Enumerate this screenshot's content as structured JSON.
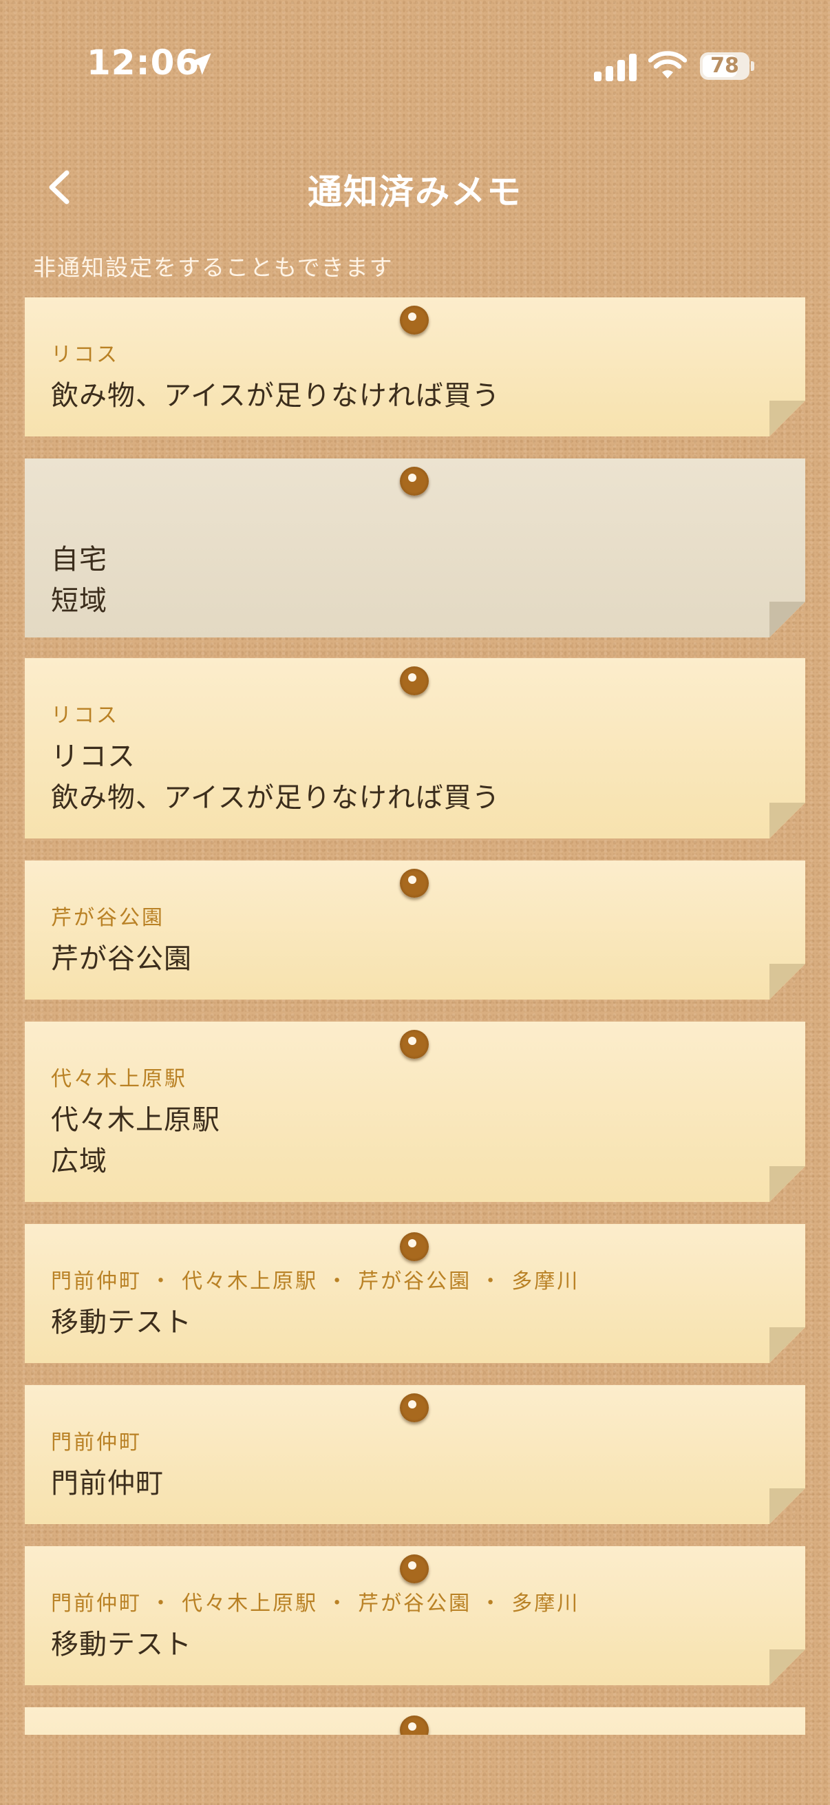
{
  "status_bar": {
    "time": "12:06",
    "battery": "78",
    "battery_percent": 78,
    "icons": [
      "location-arrow-icon",
      "cellular-signal-icon",
      "wifi-icon",
      "battery-icon"
    ]
  },
  "nav": {
    "back_icon": "chevron-left-icon",
    "title": "通知済みメモ"
  },
  "subtitle": "非通知設定をすることもできます",
  "colors": {
    "background": "#d9ae80",
    "memo": "#fcedcc",
    "memo_grey": "#ece3d0",
    "label": "#b98125",
    "text": "#3b2d1c",
    "pin": "#a8691e"
  },
  "memos": [
    {
      "label": "リコス",
      "lines": [
        "飲み物、アイスが足りなければ買う"
      ]
    },
    {
      "label": "",
      "lines": [
        "自宅",
        "短域"
      ],
      "style": "grey"
    },
    {
      "label": "リコス",
      "lines": [
        "リコス",
        "飲み物、アイスが足りなければ買う"
      ]
    },
    {
      "label": "芹が谷公園",
      "lines": [
        "芹が谷公園"
      ]
    },
    {
      "label": "代々木上原駅",
      "lines": [
        "代々木上原駅",
        "広域"
      ]
    },
    {
      "label": "門前仲町 ・ 代々木上原駅 ・ 芹が谷公園 ・ 多摩川",
      "lines": [
        "移動テスト"
      ]
    },
    {
      "label": "門前仲町",
      "lines": [
        "門前仲町"
      ]
    },
    {
      "label": "門前仲町 ・ 代々木上原駅 ・ 芹が谷公園 ・ 多摩川",
      "lines": [
        "移動テスト"
      ]
    },
    {
      "label": "",
      "lines": []
    }
  ]
}
